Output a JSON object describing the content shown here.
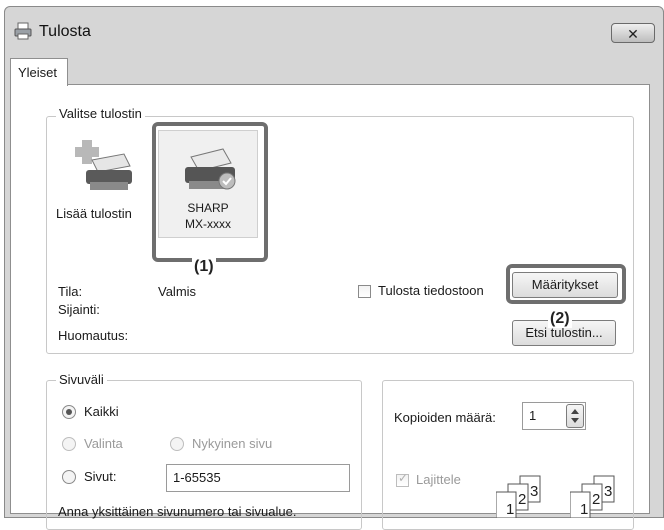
{
  "window": {
    "title": "Tulosta",
    "close_glyph": "✕"
  },
  "tabs": [
    {
      "label": "Yleiset"
    }
  ],
  "printer_group": {
    "legend": "Valitse tulostin",
    "items": [
      {
        "label": "Lisää tulostin",
        "icon": "add-printer-icon"
      },
      {
        "label_line1": "SHARP",
        "label_line2": "MX-xxxx",
        "icon": "printer-icon"
      }
    ],
    "status_label": "Tila:",
    "status_value": "Valmis",
    "location_label": "Sijainti:",
    "comment_label": "Huomautus:",
    "print_to_file_label": "Tulosta tiedostoon",
    "preferences_button": "Määritykset",
    "find_printer_button": "Etsi tulostin..."
  },
  "page_range": {
    "legend": "Sivuväli",
    "all_label": "Kaikki",
    "selection_label": "Valinta",
    "current_page_label": "Nykyinen sivu",
    "pages_label": "Sivut:",
    "pages_value": "1-65535",
    "hint": "Anna yksittäinen sivunumero tai sivualue."
  },
  "copies": {
    "label": "Kopioiden määrä:",
    "value": "1",
    "collate_label": "Lajittele"
  },
  "callouts": {
    "one": "(1)",
    "two": "(2)"
  }
}
